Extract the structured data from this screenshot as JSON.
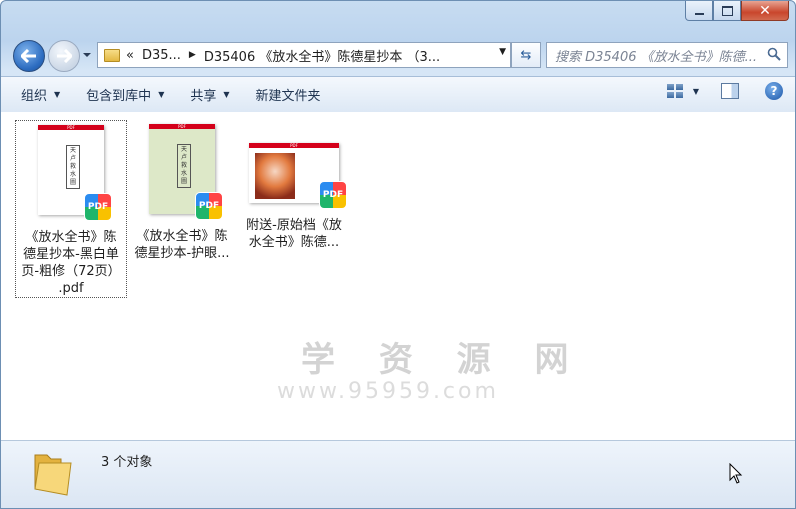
{
  "window": {
    "buttons": {
      "minimize": "–",
      "maximize": "□",
      "close": "✕"
    }
  },
  "nav": {
    "breadcrumb": [
      "D35...",
      "D35406 《放水全书》陈德星抄本 （3..."
    ],
    "overflow": "«",
    "search_placeholder": "搜索 D35406 《放水全书》陈德..."
  },
  "toolbar": {
    "organize": "组织",
    "include_in_library": "包含到库中",
    "share": "共享",
    "new_folder": "新建文件夹",
    "help": "?"
  },
  "files": [
    {
      "lines": [
        "《放水全书》陈",
        "德星抄本-黑白单",
        "页-粗修（72页）",
        ".pdf"
      ],
      "thumb_text": "天 卢 救 水 圖",
      "badge": "PDF",
      "selected": true
    },
    {
      "lines": [
        "《放水全书》陈",
        "德星抄本-护眼..."
      ],
      "thumb_text": "天 卢 救 水 圖",
      "badge": "PDF",
      "selected": false
    },
    {
      "lines": [
        "附送-原始档《放",
        "水全书》陈德..."
      ],
      "thumb_text": "",
      "badge": "PDF",
      "selected": false
    }
  ],
  "watermark": {
    "title": "学 资 源 网",
    "url": "www.95959.com"
  },
  "status": {
    "count": "3 个对象"
  }
}
